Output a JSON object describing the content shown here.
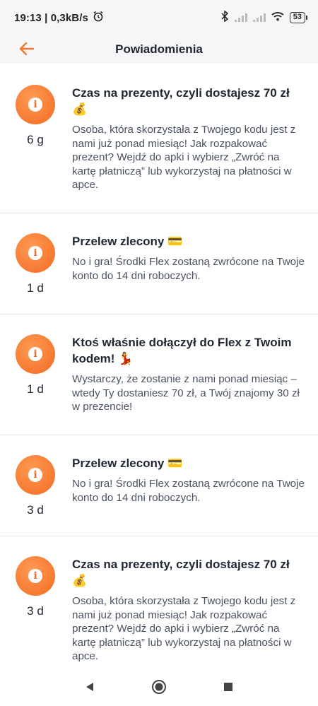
{
  "status": {
    "time_net": "19:13 | 0,3kB/s",
    "battery": "53"
  },
  "header": {
    "title": "Powiadomienia"
  },
  "notifications": [
    {
      "title": "Czas na prezenty, czyli dostajesz 70 zł 💰",
      "body": "Osoba, która skorzystała z Twojego kodu jest z nami już ponad miesiąc! Jak rozpakować prezent? Wejdź do apki i wybierz „Zwróć na kartę płatniczą” lub wykorzystaj na płatności w apce.",
      "age": "6 g"
    },
    {
      "title": "Przelew zlecony 💳",
      "body": "No i gra! Środki Flex zostaną zwrócone na Twoje konto do 14 dni roboczych.",
      "age": "1 d"
    },
    {
      "title": "Ktoś właśnie dołączył do Flex z Twoim kodem! 💃",
      "body": "Wystarczy, że zostanie z nami ponad miesiąc – wtedy Ty dostaniesz 70 zł, a Twój znajomy 30 zł w prezencie!",
      "age": "1 d"
    },
    {
      "title": "Przelew zlecony 💳",
      "body": "No i gra! Środki Flex zostaną zwrócone na Twoje konto do 14 dni roboczych.",
      "age": "3 d"
    },
    {
      "title": "Czas na prezenty, czyli dostajesz 70 zł 💰",
      "body": "Osoba, która skorzystała z Twojego kodu jest z nami już ponad miesiąc! Jak rozpakować prezent? Wejdź do apki i wybierz „Zwróć na kartę płatniczą” lub wykorzystaj na płatności w apce.",
      "age": "3 d"
    }
  ],
  "colors": {
    "accent": "#f26a23",
    "text": "#1f2733",
    "muted": "#4a5361"
  },
  "icons": {
    "back": "arrow-left-icon",
    "info": "info-icon",
    "nav": [
      "back-triangle-icon",
      "home-circle-icon",
      "recents-square-icon"
    ]
  }
}
